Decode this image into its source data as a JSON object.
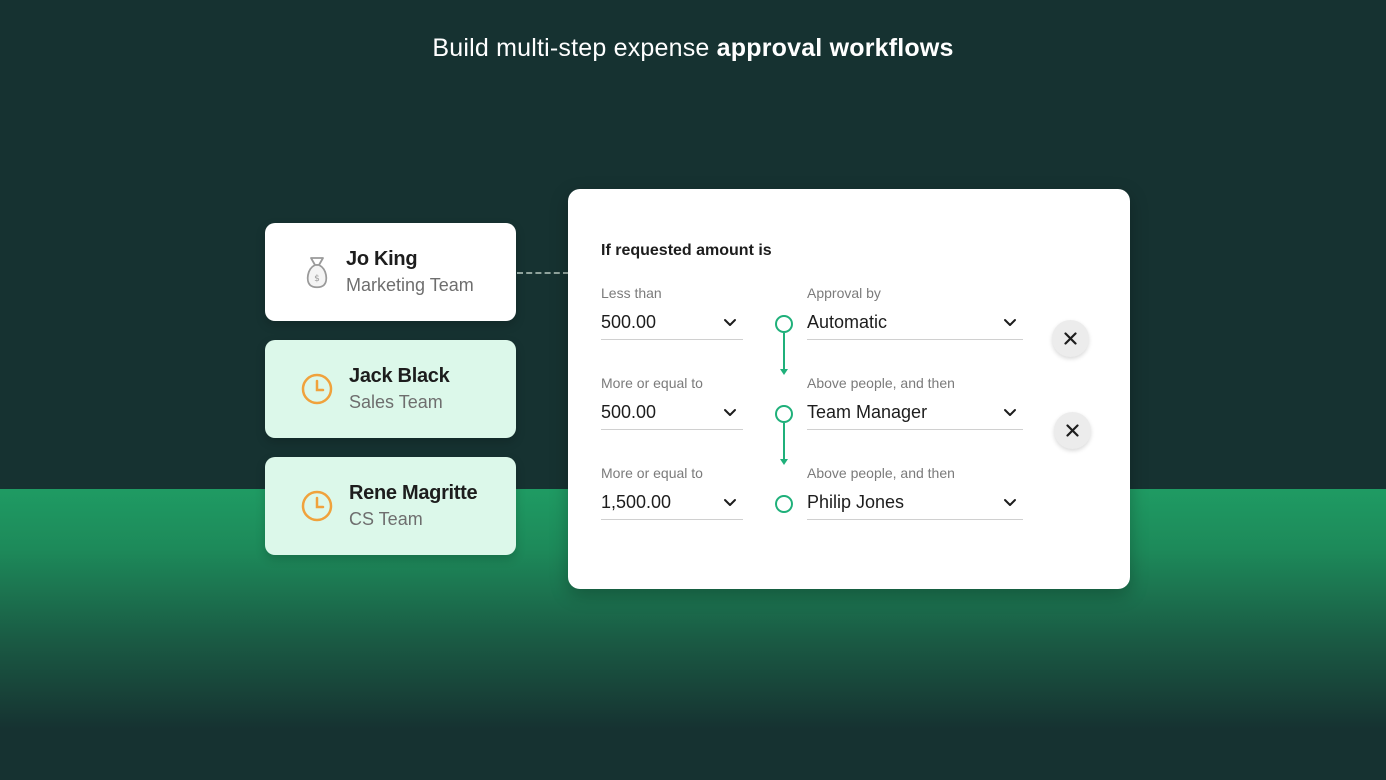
{
  "headline": {
    "regular": "Build multi-step expense ",
    "bold": "approval workflows"
  },
  "people": [
    {
      "name": "Jo King",
      "team": "Marketing Team",
      "icon": "money-bag-icon"
    },
    {
      "name": "Jack Black",
      "team": "Sales Team",
      "icon": "clock-icon"
    },
    {
      "name": "Rene Magritte",
      "team": "CS Team",
      "icon": "clock-icon"
    }
  ],
  "panel": {
    "title": "If requested amount is",
    "rules": [
      {
        "amount_label": "Less than",
        "amount_value": "500.00",
        "approver_label": "Approval by",
        "approver_value": "Automatic"
      },
      {
        "amount_label": "More or equal to",
        "amount_value": "500.00",
        "approver_label": "Above people, and then",
        "approver_value": "Team Manager"
      },
      {
        "amount_label": "More or equal to",
        "amount_value": "1,500.00",
        "approver_label": "Above people, and then",
        "approver_value": "Philip Jones"
      }
    ]
  },
  "colors": {
    "background_dark": "#163231",
    "background_green": "#1f9b63",
    "accent": "#1fb07a",
    "mint_card": "#dcf8ea",
    "clock_orange": "#f0a23c"
  }
}
